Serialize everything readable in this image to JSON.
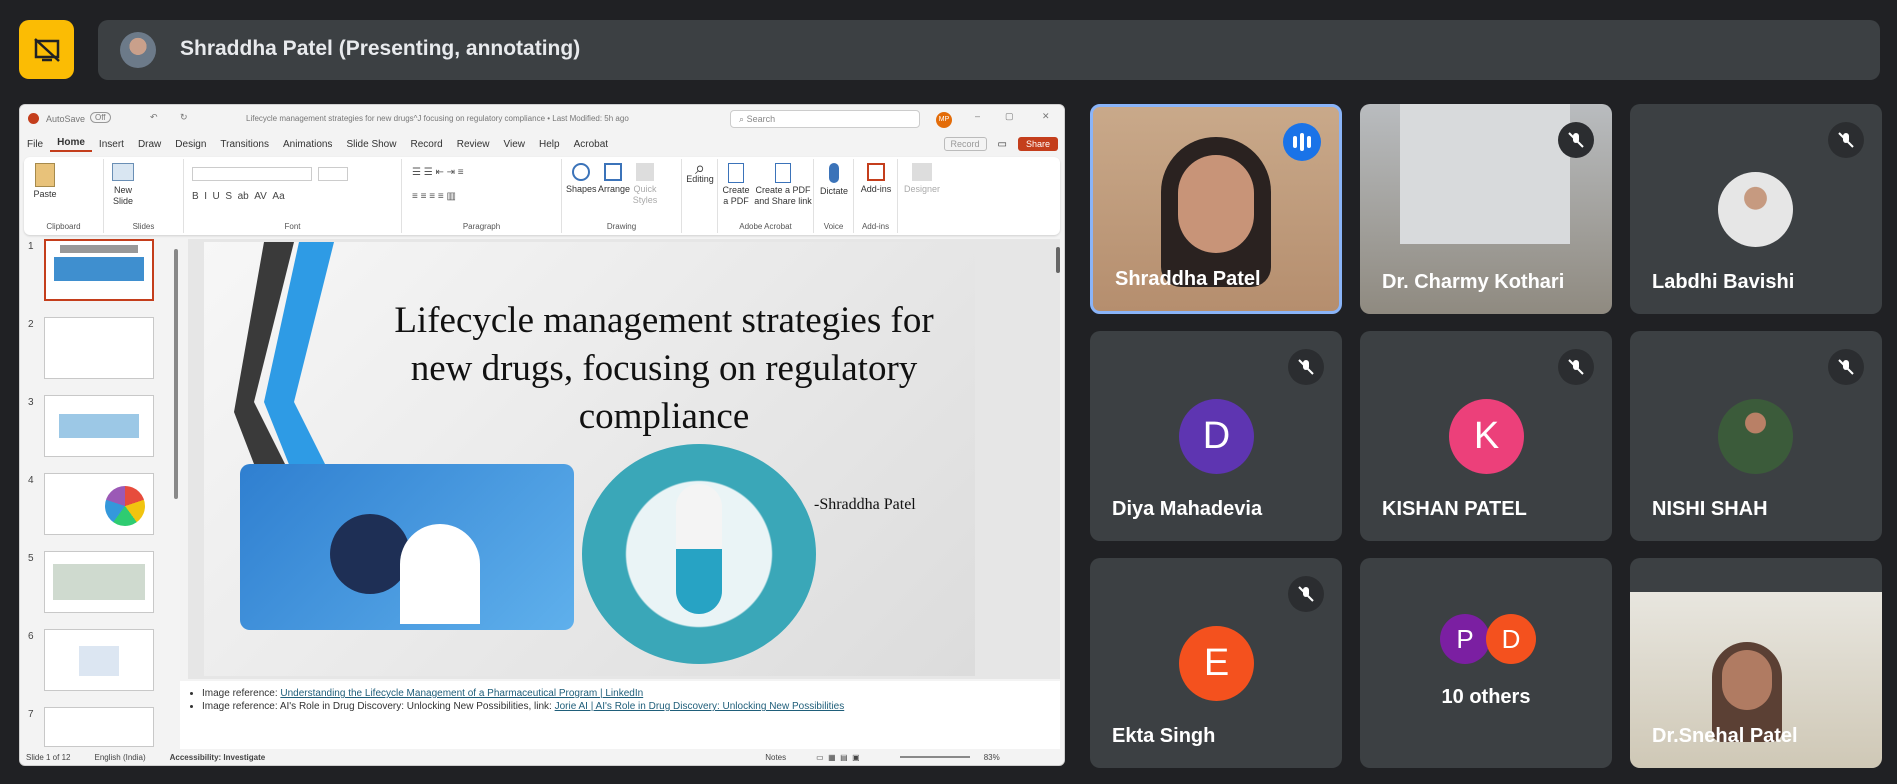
{
  "presenter_bar": {
    "name": "Shraddha Patel (Presenting, annotating)"
  },
  "ppt": {
    "title_bar": {
      "autosave": "AutoSave",
      "autosave_state": "Off",
      "doc_title": "Lifecycle management strategies for new drugs^J focusing on regulatory compliance • Last Modified: 5h ago",
      "search": "Search",
      "avatar": "MP"
    },
    "menu": [
      "File",
      "Home",
      "Insert",
      "Draw",
      "Design",
      "Transitions",
      "Animations",
      "Slide Show",
      "Record",
      "Review",
      "View",
      "Help",
      "Acrobat"
    ],
    "record": "Record",
    "share": "Share",
    "ribbon": {
      "paste": "Paste",
      "clipboard": "Clipboard",
      "new_slide": "New Slide",
      "slides": "Slides",
      "font": "Font",
      "paragraph": "Paragraph",
      "shapes": "Shapes",
      "arrange": "Arrange",
      "quick_styles": "Quick Styles",
      "drawing": "Drawing",
      "editing": "Editing",
      "create_pdf": "Create a PDF",
      "create_pdf_share": "Create a PDF and Share link",
      "adobe": "Adobe Acrobat",
      "dictate": "Dictate",
      "voice": "Voice",
      "addins": "Add-ins",
      "addins_grp": "Add-ins",
      "designer": "Designer"
    },
    "thumbs": [
      "1",
      "2",
      "3",
      "4",
      "5",
      "6",
      "7"
    ],
    "slide": {
      "title": "Lifecycle management strategies for new drugs, focusing on regulatory compliance",
      "author": "-Shraddha Patel"
    },
    "notes": {
      "line1_prefix": "Image reference: ",
      "line1_link": "Understanding the Lifecycle Management of a Pharmaceutical Program | LinkedIn",
      "line2_prefix": "Image reference: AI's Role in Drug Discovery: Unlocking New Possibilities, link: ",
      "line2_link": "Jorie AI | AI's Role in Drug Discovery: Unlocking New Possibilities"
    },
    "status": {
      "slide": "Slide 1 of 12",
      "lang": "English (India)",
      "accessibility": "Accessibility: Investigate",
      "notes": "Notes",
      "zoom": "83%"
    }
  },
  "participants": [
    {
      "name": "Shraddha Patel"
    },
    {
      "name": "Dr. Charmy Kothari"
    },
    {
      "name": "Labdhi Bavishi"
    },
    {
      "name": "Diya Mahadevia",
      "initial": "D"
    },
    {
      "name": "KISHAN PATEL",
      "initial": "K"
    },
    {
      "name": "NISHI SHAH"
    },
    {
      "name": "Ekta Singh",
      "initial": "E"
    },
    {
      "name": "10 others",
      "i1": "P",
      "i2": "D"
    },
    {
      "name": "Dr.Snehal Patel"
    }
  ],
  "colors": {
    "bg": "#202124",
    "tile": "#3c4043",
    "accent": "#fbbc04",
    "active": "#8ab4f8",
    "ppt_red": "#c43e1c"
  }
}
